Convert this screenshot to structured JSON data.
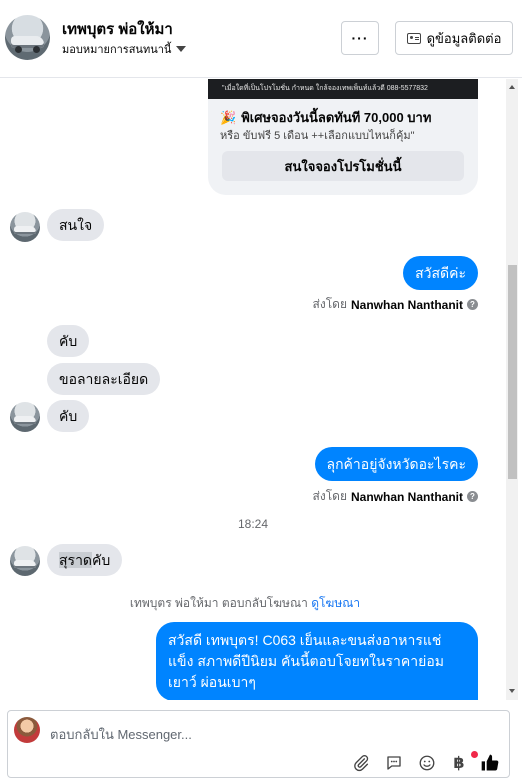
{
  "header": {
    "title": "เทพบุตร พ่อให้มา",
    "subtitle": "มอบหมายการสนทนานี้",
    "more_label": "···",
    "contact_label": "ดูข้อมูลติดต่อ"
  },
  "promo": {
    "image_caption": "\"เมื่อใดที่เป็นโปรโมชั่น กำหนด ใกล้จองเทพเพ็นท์แล้วดี 088-5577832",
    "title": "พิเศษจองวันนี้ลดทันที 70,000 บาท",
    "subtitle": "หรือ ขับฟรี 5 เดือน ++เลือกแบบไหนก็คุ้ม\"",
    "button": "สนใจจองโปรโมชั่นนี้"
  },
  "messages": {
    "in_1": "สนใจ",
    "out_1": "สวัสดีค่ะ",
    "sent_by_label": "ส่งโดย",
    "sent_by_name": "Nanwhan Nanthanit",
    "in_2": "คับ",
    "in_3": "ขอลายละเอียด",
    "in_4": "คับ",
    "out_2": "ลุกค้าอยู่จังหวัดอะไรคะ",
    "time": "18:24",
    "in_5_highlight": "สุราด",
    "in_5_rest": "คับ",
    "ad_reply_text": "เทพบุตร พ่อให้มา ตอบกลับโฆษณา",
    "ad_reply_link": "ดูโฆษณา",
    "out_3": "สวัสดี เทพบุตร!  C063 เย็นและขนส่งอาหารแช่แข็ง สภาพดีปีนิยม คันนี้ตอบโจยทในราคาย่อมเยาว์ ผ่อนเบาๆ"
  },
  "composer": {
    "placeholder": "ตอบกลับใน Messenger..."
  },
  "colors": {
    "brand_blue": "#0084ff",
    "incoming_bubble": "#e4e6eb",
    "link": "#1877f2"
  }
}
